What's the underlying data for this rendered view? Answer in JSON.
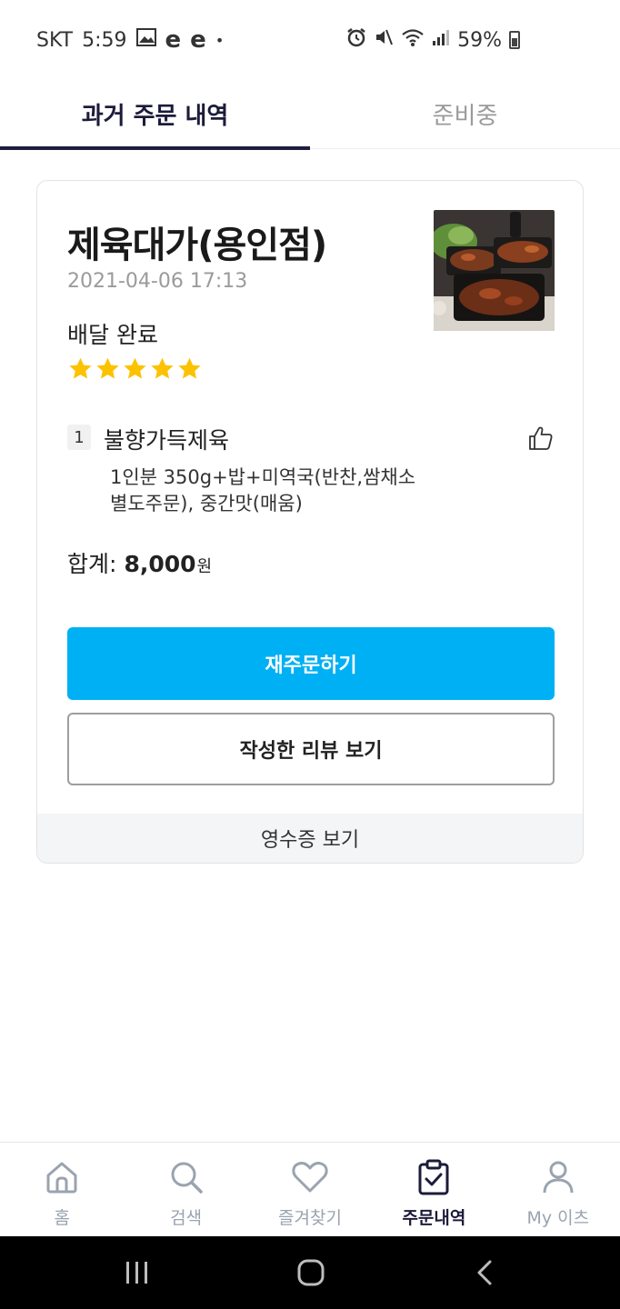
{
  "status_bar": {
    "carrier": "SKT",
    "time": "5:59",
    "app_icon_1": "e",
    "app_icon_2": "e",
    "dot": "•",
    "battery": "59%"
  },
  "tabs": [
    {
      "label": "과거 주문 내역",
      "active": true
    },
    {
      "label": "준비중",
      "active": false
    }
  ],
  "order": {
    "store_name": "제육대가(용인점)",
    "date": "2021-04-06 17:13",
    "status": "배달 완료",
    "rating": 5,
    "items": [
      {
        "qty": "1",
        "name": "불향가득제육",
        "options_line1": "1인분 350g+밥+미역국(반찬,쌈채소",
        "options_line2": "별도주문), 중간맛(매움)"
      }
    ],
    "total_label": "합계:",
    "total_amount": "8,000",
    "total_unit": "원",
    "reorder_label": "재주문하기",
    "review_label": "작성한 리뷰 보기",
    "receipt_label": "영수증 보기"
  },
  "bottom_nav": [
    {
      "label": "홈",
      "icon": "home-icon",
      "active": false
    },
    {
      "label": "검색",
      "icon": "search-icon",
      "active": false
    },
    {
      "label": "즐겨찾기",
      "icon": "heart-icon",
      "active": false
    },
    {
      "label": "주문내역",
      "icon": "clipboard-check-icon",
      "active": true
    },
    {
      "label": "My 이츠",
      "icon": "user-icon",
      "active": false
    }
  ],
  "colors": {
    "accent": "#00b0f4",
    "star": "#fcc200",
    "tab_indicator": "#1f1d3d",
    "nav_active": "#1c1b3a",
    "nav_inactive": "#9aa3b0"
  }
}
